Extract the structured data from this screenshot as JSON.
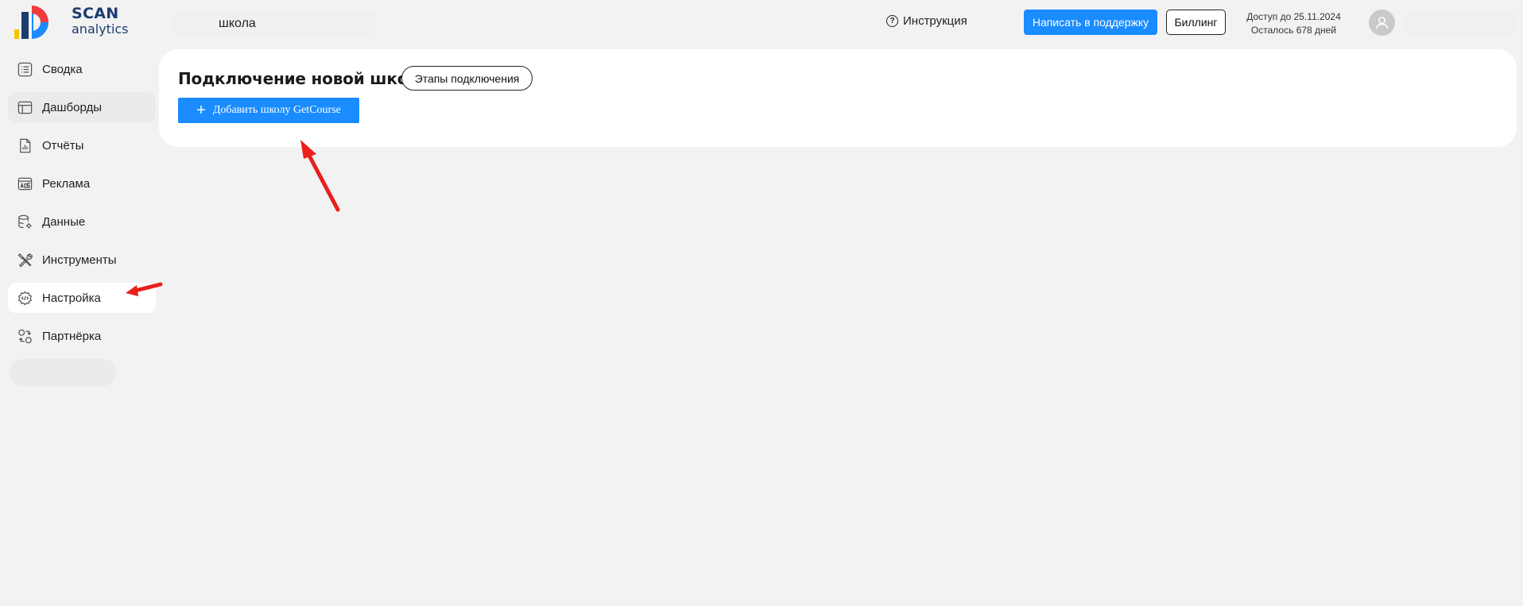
{
  "brand": {
    "name_bold": "SCAN",
    "name_light": "analytics",
    "colors": {
      "navy": "#1b3d6e",
      "blue": "#1a8cff",
      "red": "#ef3b3b",
      "yellow": "#f5c400"
    }
  },
  "header": {
    "school_name": "школа",
    "help_label": "Инструкция",
    "help_icon": "question-circle-icon",
    "support_label": "Написать в поддержку",
    "billing_label": "Биллинг",
    "access_until": "Доступ до 25.11.2024",
    "days_left": "Осталось 678 дней",
    "avatar_icon": "user-avatar-icon"
  },
  "sidebar": {
    "items": [
      {
        "label": "Сводка",
        "icon": "summary-list-icon"
      },
      {
        "label": "Дашборды",
        "icon": "dashboard-layout-icon"
      },
      {
        "label": "Отчёты",
        "icon": "report-chart-icon"
      },
      {
        "label": "Реклама",
        "icon": "ads-icon"
      },
      {
        "label": "Данные",
        "icon": "database-gear-icon"
      },
      {
        "label": "Инструменты",
        "icon": "tools-icon"
      },
      {
        "label": "Настройка",
        "icon": "settings-gear-icon"
      },
      {
        "label": "Партнёрка",
        "icon": "partner-exchange-icon"
      }
    ],
    "active_item": "Настройка"
  },
  "main": {
    "title": "Подключение новой школы",
    "stages_button": "Этапы подключения",
    "add_button": "Добавить школу GetCourse",
    "add_icon": "plus-icon"
  },
  "annotations": {
    "arrow_color": "#e8201b"
  }
}
